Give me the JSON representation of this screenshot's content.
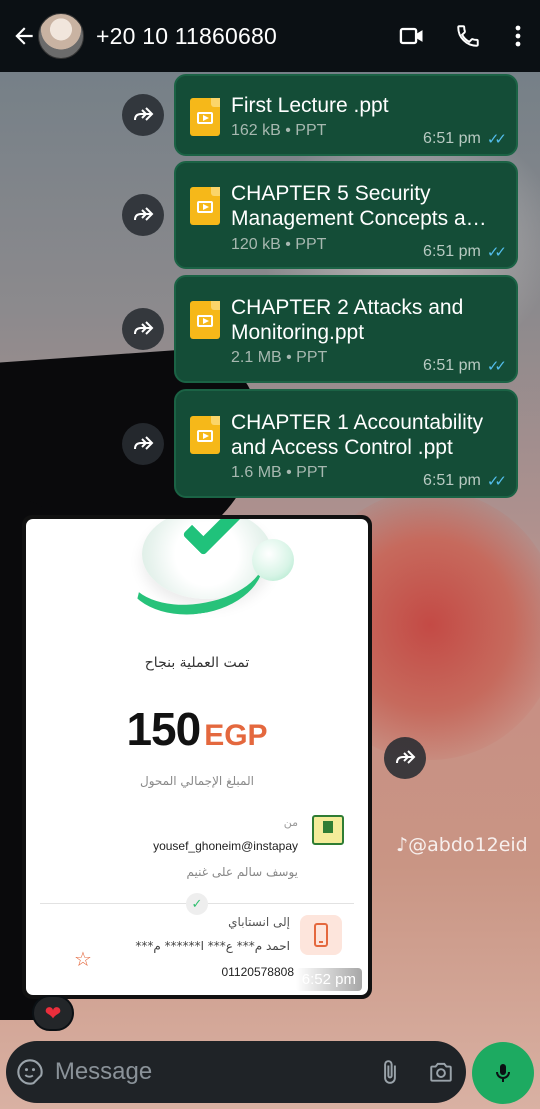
{
  "header": {
    "contact_name": "+20 10 11860680",
    "icons": [
      "back-arrow-icon",
      "avatar",
      "video-call-icon",
      "phone-call-icon",
      "more-options-icon"
    ]
  },
  "messages": [
    {
      "title": "First Lecture .ppt",
      "meta": "162 kB • PPT",
      "time": "6:51 pm",
      "ticks": "✓✓"
    },
    {
      "title": "CHAPTER 5 Security Management Concepts a…",
      "meta": "120 kB • PPT",
      "time": "6:51 pm",
      "ticks": "✓✓"
    },
    {
      "title": "CHAPTER 2 Attacks and Monitoring.ppt",
      "meta": "2.1 MB • PPT",
      "time": "6:51 pm",
      "ticks": "✓✓"
    },
    {
      "title": "CHAPTER 1 Accountability and Access Control .ppt",
      "meta": "1.6 MB • PPT",
      "time": "6:51 pm",
      "ticks": "✓✓"
    }
  ],
  "receipt": {
    "success_text": "تمت العملية بنجاح",
    "amount": "150",
    "currency": "EGP",
    "total_label": "المبلغ الإجمالي المحول",
    "from_label": "من",
    "from_handle": "yousef_ghoneim@instapay",
    "from_name": "يوسف سالم على غنيم",
    "to_label": "إلى انستاباي",
    "to_name": "احمد م*** ع*** ا****** م***",
    "to_phone": "01120578808",
    "time": "6:52 pm"
  },
  "reaction": "❤",
  "watermark": "@abdo12eid",
  "composer": {
    "placeholder": "Message"
  },
  "colors": {
    "header_bg": "#0b1014",
    "bubble_bg": "#144d37",
    "doc_icon": "#f6b819",
    "read_ticks": "#53bdeb",
    "mic_button": "#1daa61",
    "amount_currency": "#e4683e"
  }
}
